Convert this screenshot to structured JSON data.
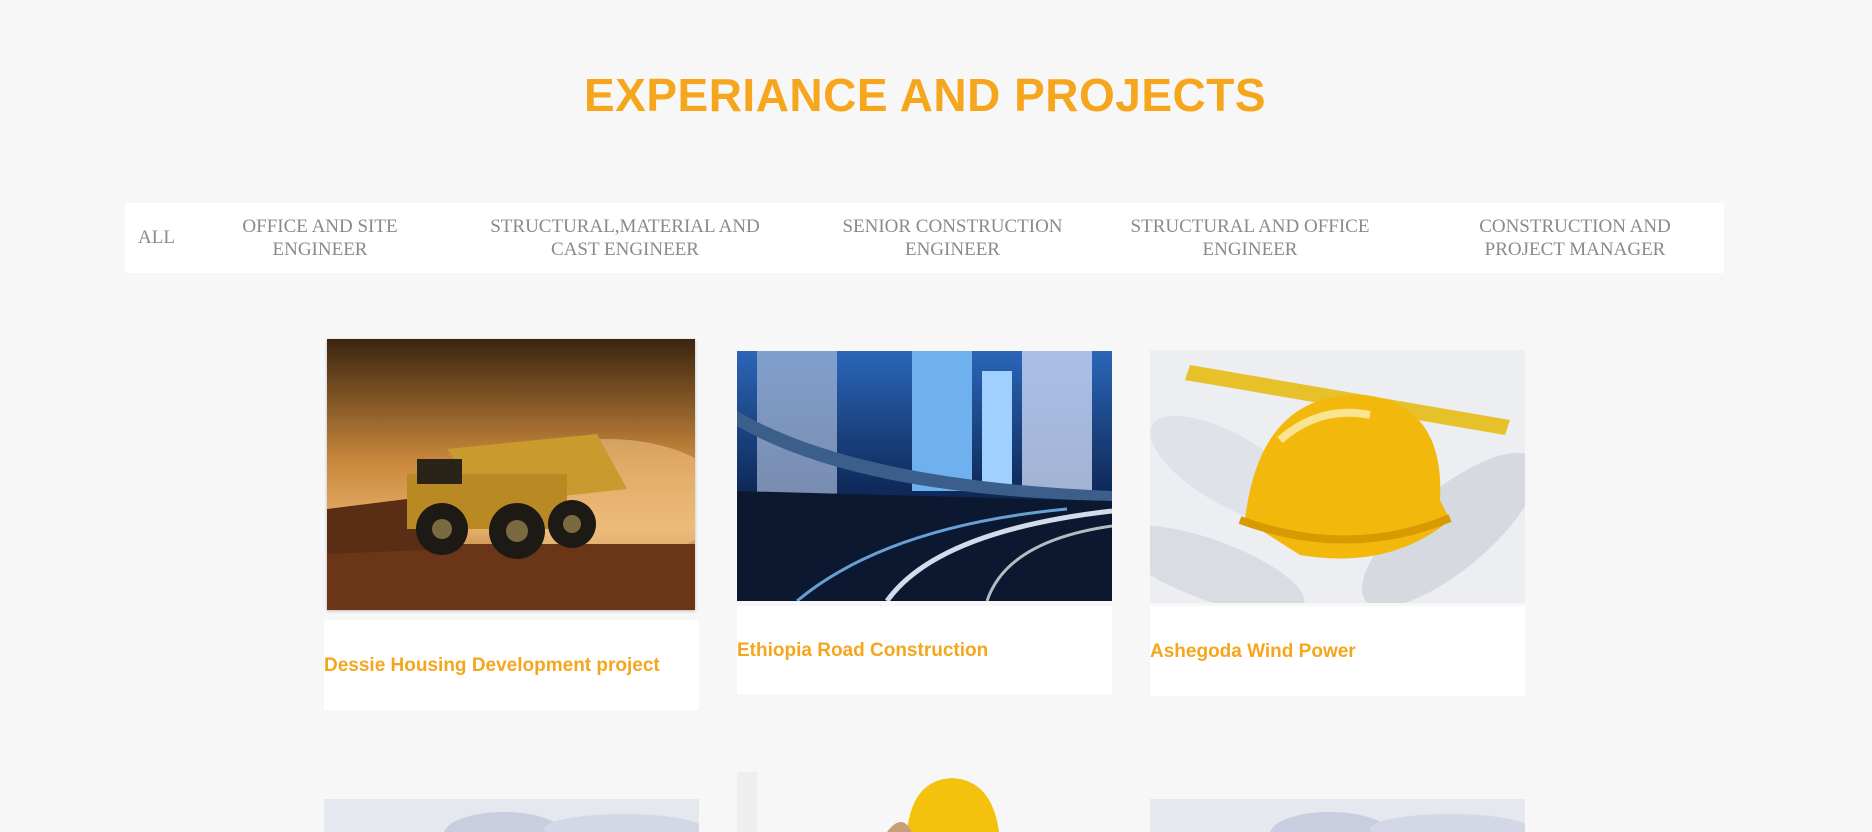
{
  "section": {
    "title": "EXPERIANCE AND PROJECTS"
  },
  "filters": [
    {
      "label": "ALL"
    },
    {
      "label": "OFFICE AND SITE ENGINEER"
    },
    {
      "label": "STRUCTURAL,MATERIAL AND CAST ENGINEER"
    },
    {
      "label": "SENIOR CONSTRUCTION ENGINEER"
    },
    {
      "label": "STRUCTURAL AND OFFICE ENGINEER"
    },
    {
      "label": "CONSTRUCTION AND PROJECT MANAGER"
    }
  ],
  "projects": [
    {
      "title": "Dessie Housing Development project",
      "image": "mining-dump-truck-photo"
    },
    {
      "title": "Ethiopia Road Construction",
      "image": "city-highway-night-photo"
    },
    {
      "title": "Ashegoda Wind Power",
      "image": "hard-hat-on-blueprints-photo"
    }
  ],
  "colors": {
    "accent": "#f5a61d",
    "filter_text": "#8a8a8a",
    "background": "#f7f7f7"
  }
}
